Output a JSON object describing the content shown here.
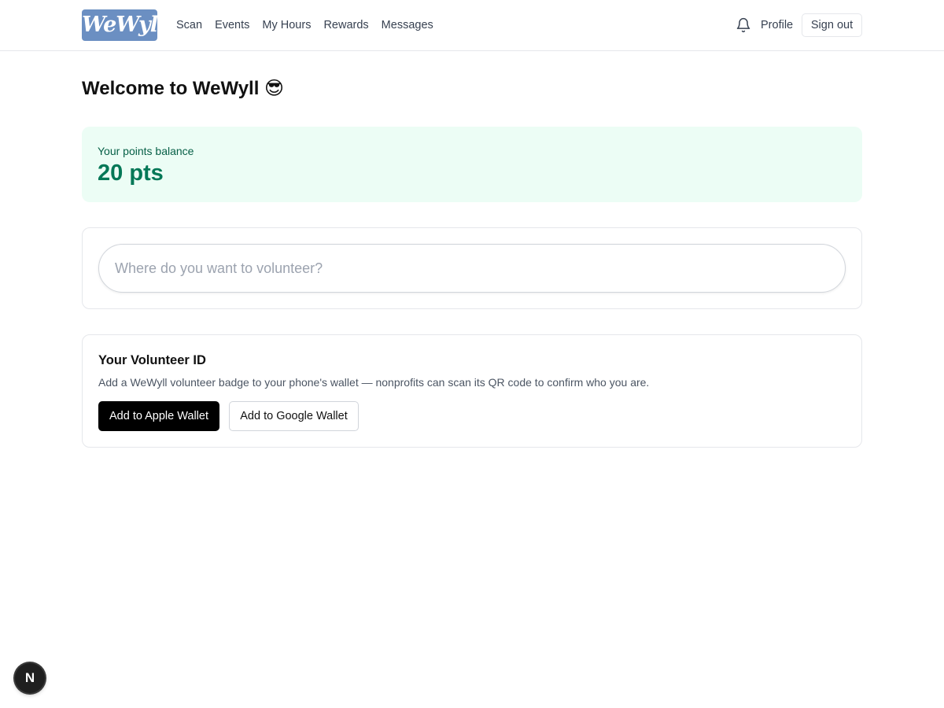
{
  "header": {
    "logo_text": "WeWyll",
    "nav": [
      {
        "label": "Scan"
      },
      {
        "label": "Events"
      },
      {
        "label": "My Hours"
      },
      {
        "label": "Rewards"
      },
      {
        "label": "Messages"
      }
    ],
    "bell_icon": "bell-icon",
    "profile_label": "Profile",
    "signout_label": "Sign out"
  },
  "main": {
    "title": "Welcome to WeWyll 😎",
    "points": {
      "label": "Your points balance",
      "value": "20 pts"
    },
    "search": {
      "placeholder": "Where do you want to volunteer?",
      "value": ""
    },
    "volunteer_id": {
      "title": "Your Volunteer ID",
      "description": "Add a WeWyll volunteer badge to your phone's wallet — nonprofits can scan its QR code to confirm who you are.",
      "apple_button": "Add to Apple Wallet",
      "google_button": "Add to Google Wallet"
    }
  },
  "dev_badge": {
    "letter": "N"
  },
  "colors": {
    "logo_bg": "#6b8fc2",
    "points_bg": "#ecfdf5",
    "points_text": "#047857"
  }
}
